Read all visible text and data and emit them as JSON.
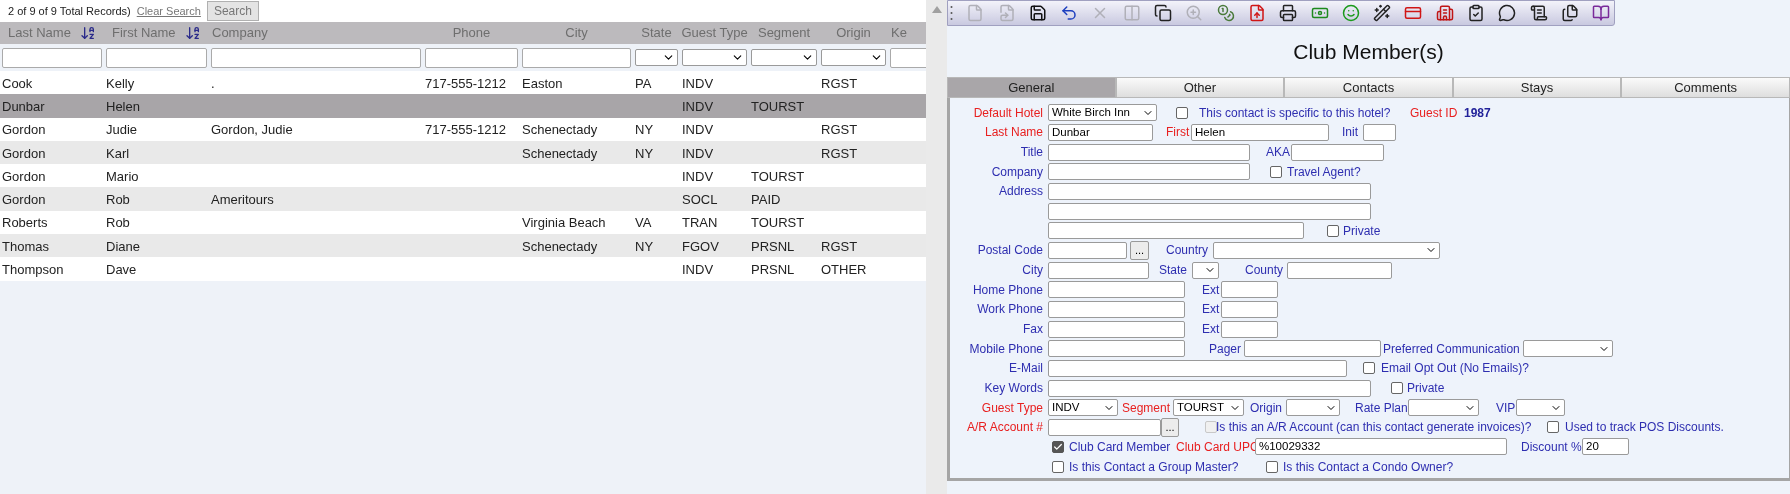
{
  "records_summary": "2 of 9 of 9 Total Records)",
  "clear_search": "Clear Search",
  "search_button": "Search",
  "table": {
    "columns": [
      {
        "label": "Last Name",
        "sortable": true
      },
      {
        "label": "First Name",
        "sortable": true
      },
      {
        "label": "Company",
        "sortable": false
      },
      {
        "label": "Phone",
        "sortable": false
      },
      {
        "label": "City",
        "sortable": false
      },
      {
        "label": "State",
        "sortable": false
      },
      {
        "label": "Guest Type",
        "sortable": false
      },
      {
        "label": "Segment",
        "sortable": false
      },
      {
        "label": "Origin",
        "sortable": false
      },
      {
        "label": "Ke",
        "sortable": false
      }
    ],
    "filters": [
      {
        "kind": "text"
      },
      {
        "kind": "text"
      },
      {
        "kind": "text"
      },
      {
        "kind": "text"
      },
      {
        "kind": "text"
      },
      {
        "kind": "select"
      },
      {
        "kind": "select"
      },
      {
        "kind": "select"
      },
      {
        "kind": "select"
      },
      {
        "kind": "text"
      }
    ],
    "rows": [
      {
        "selected": false,
        "cells": [
          "Cook",
          "Kelly",
          ".",
          "717-555-1212",
          "Easton",
          "PA",
          "INDV",
          "",
          "RGST"
        ]
      },
      {
        "selected": true,
        "cells": [
          "Dunbar",
          "Helen",
          "",
          "",
          "",
          "",
          "INDV",
          "TOURST",
          ""
        ]
      },
      {
        "selected": false,
        "cells": [
          "Gordon",
          "Judie",
          "Gordon, Judie",
          "717-555-1212",
          "Schenectady",
          "NY",
          "INDV",
          "",
          "RGST"
        ]
      },
      {
        "selected": false,
        "cells": [
          "Gordon",
          "Karl",
          "",
          "",
          "Schenectady",
          "NY",
          "INDV",
          "",
          "RGST"
        ]
      },
      {
        "selected": false,
        "cells": [
          "Gordon",
          "Mario",
          "",
          "",
          "",
          "",
          "INDV",
          "TOURST",
          ""
        ]
      },
      {
        "selected": false,
        "cells": [
          "Gordon",
          "Rob",
          "Ameritours",
          "",
          "",
          "",
          "SOCL",
          "PAID",
          ""
        ]
      },
      {
        "selected": false,
        "cells": [
          "Roberts",
          "Rob",
          "",
          "",
          "Virginia Beach",
          "VA",
          "TRAN",
          "TOURST",
          ""
        ]
      },
      {
        "selected": false,
        "cells": [
          "Thomas",
          "Diane",
          "",
          "",
          "Schenectady",
          "NY",
          "FGOV",
          "PRSNL",
          "RGST"
        ]
      },
      {
        "selected": false,
        "cells": [
          "Thompson",
          "Dave",
          "",
          "",
          "",
          "",
          "INDV",
          "PRSNL",
          "OTHER"
        ]
      }
    ]
  },
  "toolbar": [
    {
      "disabled": true
    },
    {
      "disabled": true
    },
    {
      "disabled": false
    },
    {
      "disabled": false
    },
    {
      "disabled": true
    },
    {
      "disabled": true
    },
    {
      "disabled": false
    },
    {
      "disabled": true
    },
    {
      "disabled": false
    },
    {
      "disabled": false
    },
    {
      "disabled": false
    },
    {
      "disabled": false
    },
    {
      "disabled": false
    },
    {
      "disabled": false
    },
    {
      "disabled": false
    },
    {
      "disabled": false
    },
    {
      "disabled": false
    },
    {
      "disabled": false
    },
    {
      "disabled": false
    },
    {
      "disabled": false
    },
    {
      "disabled": false
    }
  ],
  "title": "Club Member(s)",
  "tabs": [
    {
      "label": "General",
      "selected": true
    },
    {
      "label": "Other",
      "selected": false
    },
    {
      "label": "Contacts",
      "selected": false
    },
    {
      "label": "Stays",
      "selected": false
    },
    {
      "label": "Comments",
      "selected": false
    }
  ],
  "form": {
    "rows": [
      {
        "label": {
          "text": "Default Hotel",
          "required": true
        },
        "items": [
          {
            "kind": "select",
            "value": "White Birch Inn"
          },
          {
            "kind": "checkbox",
            "checked": false,
            "disabled": false
          },
          {
            "kind": "text",
            "text": "This contact is specific to this hotel?",
            "required": false
          },
          {
            "kind": "text",
            "text": "Guest ID",
            "required": true
          },
          {
            "kind": "value",
            "text": "1987"
          }
        ]
      },
      {
        "label": {
          "text": "Last Name",
          "required": true
        },
        "items": [
          {
            "kind": "input",
            "value": "Dunbar"
          },
          {
            "kind": "text",
            "text": "First",
            "required": true
          },
          {
            "kind": "input",
            "value": "Helen"
          },
          {
            "kind": "text",
            "text": "Init",
            "required": false
          },
          {
            "kind": "input"
          }
        ]
      },
      {
        "label": {
          "text": "Title",
          "required": false
        },
        "items": [
          {
            "kind": "input"
          },
          {
            "kind": "text",
            "text": "AKA",
            "required": false
          },
          {
            "kind": "input"
          }
        ]
      },
      {
        "label": {
          "text": "Company",
          "required": false
        },
        "items": [
          {
            "kind": "input"
          },
          {
            "kind": "checkbox",
            "checked": false,
            "disabled": false
          },
          {
            "kind": "text",
            "text": "Travel Agent?",
            "required": false
          }
        ]
      },
      {
        "label": {
          "text": "Address",
          "required": false
        },
        "items": [
          {
            "kind": "input"
          }
        ]
      },
      {
        "items": [
          {
            "kind": "input"
          }
        ]
      },
      {
        "items": [
          {
            "kind": "input"
          },
          {
            "kind": "checkbox",
            "checked": false,
            "disabled": false
          },
          {
            "kind": "text",
            "text": "Private",
            "required": false
          }
        ]
      },
      {
        "label": {
          "text": "Postal Code",
          "required": false
        },
        "items": [
          {
            "kind": "input"
          },
          {
            "kind": "button",
            "text": "..."
          },
          {
            "kind": "text",
            "text": "Country",
            "required": false
          },
          {
            "kind": "select"
          }
        ]
      },
      {
        "label": {
          "text": "City",
          "required": false
        },
        "items": [
          {
            "kind": "input"
          },
          {
            "kind": "text",
            "text": "State",
            "required": false
          },
          {
            "kind": "select"
          },
          {
            "kind": "text",
            "text": "County",
            "required": false
          },
          {
            "kind": "input"
          }
        ]
      },
      {
        "label": {
          "text": "Home Phone",
          "required": false
        },
        "items": [
          {
            "kind": "input"
          },
          {
            "kind": "text",
            "text": "Ext",
            "required": false
          },
          {
            "kind": "input"
          }
        ]
      },
      {
        "label": {
          "text": "Work Phone",
          "required": false
        },
        "items": [
          {
            "kind": "input"
          },
          {
            "kind": "text",
            "text": "Ext",
            "required": false
          },
          {
            "kind": "input"
          }
        ]
      },
      {
        "label": {
          "text": "Fax",
          "required": false
        },
        "items": [
          {
            "kind": "input"
          },
          {
            "kind": "text",
            "text": "Ext",
            "required": false
          },
          {
            "kind": "input"
          }
        ]
      },
      {
        "label": {
          "text": "Mobile Phone",
          "required": false
        },
        "items": [
          {
            "kind": "input"
          },
          {
            "kind": "text",
            "text": "Pager",
            "required": false
          },
          {
            "kind": "input"
          },
          {
            "kind": "text",
            "text": "Preferred Communication",
            "required": false
          },
          {
            "kind": "select"
          }
        ]
      },
      {
        "label": {
          "text": "E-Mail",
          "required": false
        },
        "items": [
          {
            "kind": "input"
          },
          {
            "kind": "checkbox",
            "checked": false,
            "disabled": false
          },
          {
            "kind": "text",
            "text": "Email Opt Out (No Emails)?",
            "required": false
          }
        ]
      },
      {
        "label": {
          "text": "Key Words",
          "required": false
        },
        "items": [
          {
            "kind": "input"
          },
          {
            "kind": "checkbox",
            "checked": false,
            "disabled": false
          },
          {
            "kind": "text",
            "text": "Private",
            "required": false
          }
        ]
      },
      {
        "label": {
          "text": "Guest Type",
          "required": true
        },
        "items": [
          {
            "kind": "select",
            "value": "INDV"
          },
          {
            "kind": "text",
            "text": "Segment",
            "required": true
          },
          {
            "kind": "select",
            "value": "TOURST"
          },
          {
            "kind": "text",
            "text": "Origin",
            "required": false
          },
          {
            "kind": "select"
          },
          {
            "kind": "text",
            "text": "Rate Plan",
            "required": false
          },
          {
            "kind": "select"
          },
          {
            "kind": "text",
            "text": "VIP",
            "required": false
          },
          {
            "kind": "select"
          }
        ]
      },
      {
        "label": {
          "text": "A/R Account #",
          "required": true
        },
        "items": [
          {
            "kind": "input"
          },
          {
            "kind": "button",
            "text": "..."
          },
          {
            "kind": "checkbox",
            "checked": false,
            "disabled": true
          },
          {
            "kind": "text",
            "text": "Is this an A/R Account (can this contact generate invoices)?",
            "required": false
          },
          {
            "kind": "checkbox",
            "checked": false,
            "disabled": false
          },
          {
            "kind": "text",
            "text": "Used to track POS Discounts.",
            "required": false
          }
        ]
      },
      {
        "items": [
          {
            "kind": "checkbox",
            "checked": true,
            "disabled": false
          },
          {
            "kind": "text",
            "text": "Club Card Member",
            "required": false
          },
          {
            "kind": "text",
            "text": "Club Card UPC",
            "required": true
          },
          {
            "kind": "input",
            "value": "%10029332"
          },
          {
            "kind": "text",
            "text": "Discount %",
            "required": false
          },
          {
            "kind": "input",
            "value": "20"
          }
        ]
      },
      {
        "items": [
          {
            "kind": "checkbox",
            "checked": false,
            "disabled": false
          },
          {
            "kind": "text",
            "text": "Is this Contact a Group Master?",
            "required": false
          },
          {
            "kind": "checkbox",
            "checked": false,
            "disabled": false
          },
          {
            "kind": "text",
            "text": "Is this Contact a Condo Owner?",
            "required": false
          }
        ]
      }
    ]
  }
}
